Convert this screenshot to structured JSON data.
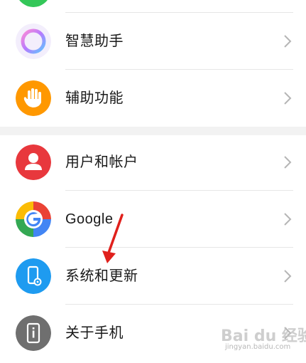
{
  "settings": {
    "items": [
      {
        "label": "智慧助手",
        "icon": "assistant-ring-icon"
      },
      {
        "label": "辅助功能",
        "icon": "hand-icon"
      },
      {
        "label": "用户和帐户",
        "icon": "user-icon"
      },
      {
        "label": "Google",
        "icon": "google-icon"
      },
      {
        "label": "系统和更新",
        "icon": "system-update-icon"
      },
      {
        "label": "关于手机",
        "icon": "about-phone-icon"
      }
    ]
  },
  "watermark": {
    "main": "Bai du 经验",
    "sub": "jingyan.baidu.com"
  },
  "colors": {
    "assistant_ring": "#b57bff",
    "accessibility": "#ff9800",
    "user": "#e8383d",
    "system": "#1e9bf0",
    "about": "#6f6f6f",
    "arrow": "#e0201c",
    "chevron": "#b5b5b5"
  }
}
